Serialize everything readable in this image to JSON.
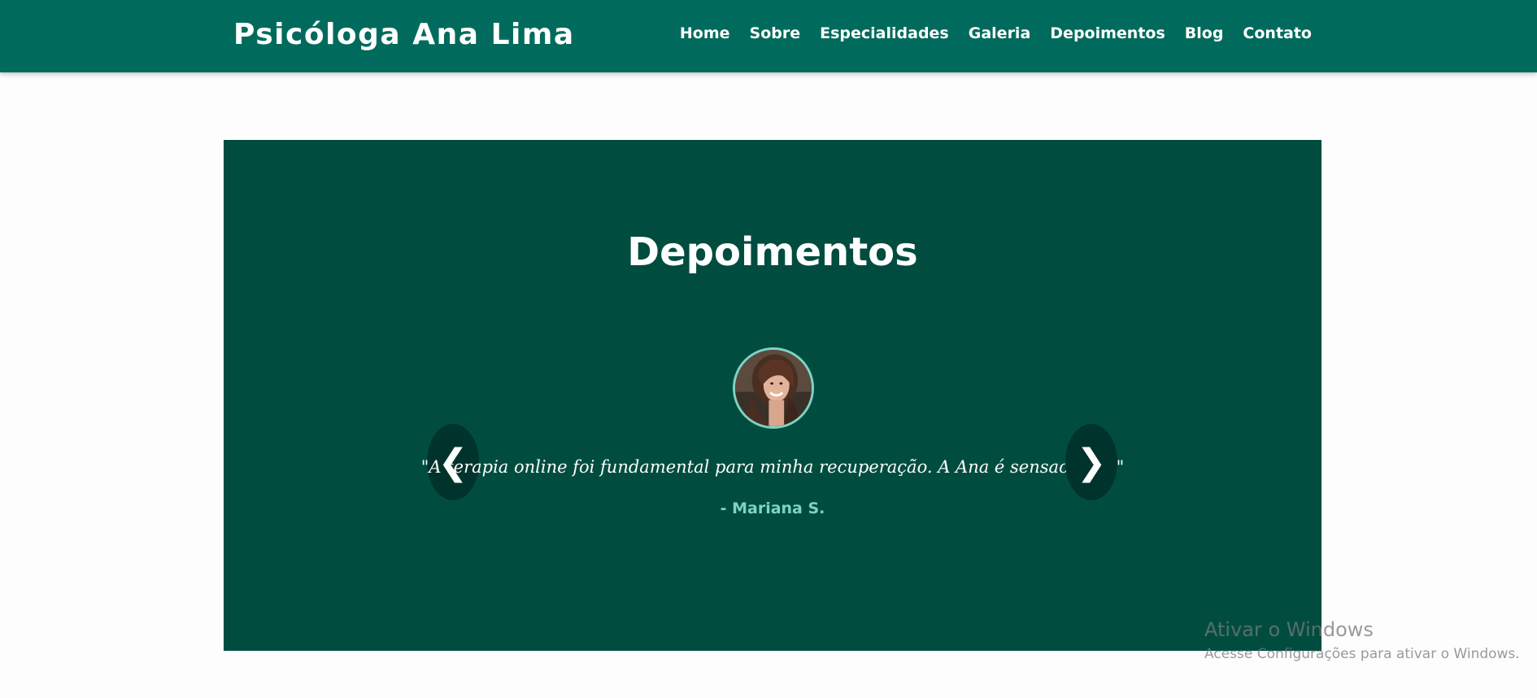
{
  "header": {
    "brand": "Psicóloga Ana Lima",
    "nav": [
      "Home",
      "Sobre",
      "Especialidades",
      "Galeria",
      "Depoimentos",
      "Blog",
      "Contato"
    ]
  },
  "testimonials": {
    "title": "Depoimentos",
    "quote": "\"A terapia online foi fundamental para minha recuperação. A Ana é sensacional.\"",
    "author": "- Mariana S.",
    "prev_arrow": "❮",
    "next_arrow": "❯",
    "avatar_icon": "avatar-photo"
  },
  "watermark": {
    "title": "Ativar o Windows",
    "subtitle": "Acesse Configurações para ativar o Windows."
  },
  "colors": {
    "header_bg": "#006b5c",
    "section_bg": "#004d40",
    "accent": "#7fd3c3",
    "arrow_bg": "#00332b"
  }
}
